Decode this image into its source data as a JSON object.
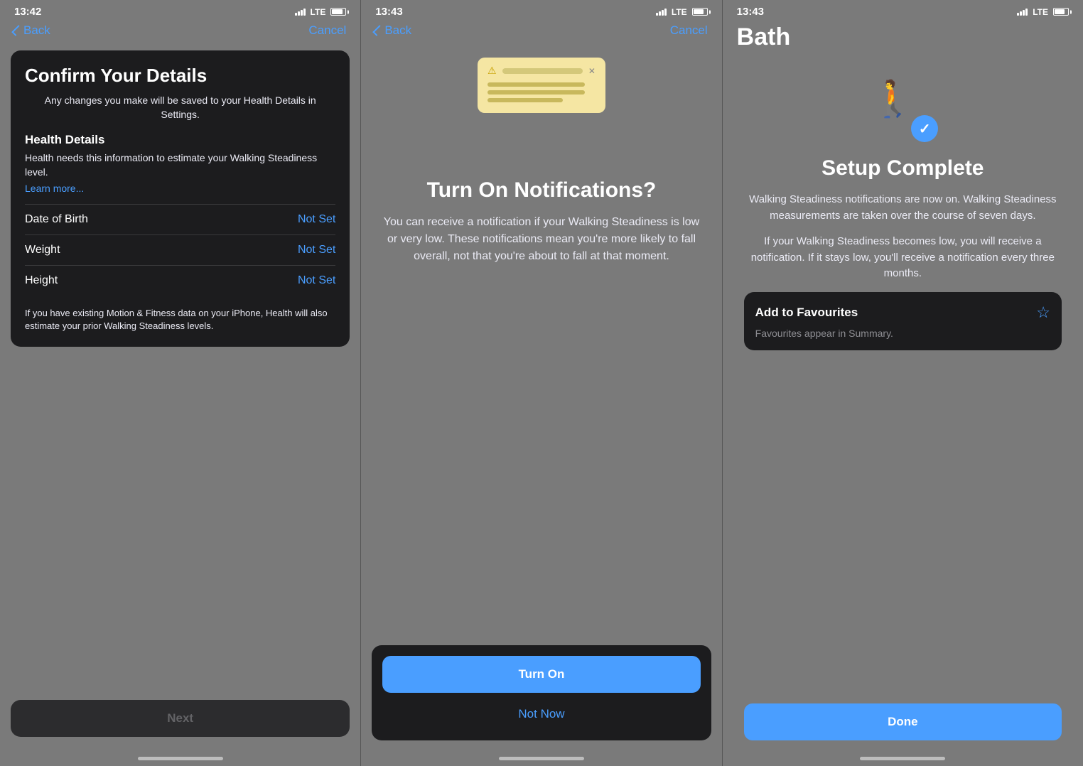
{
  "screen1": {
    "time": "13:42",
    "nav": {
      "back": "Back",
      "cancel": "Cancel"
    },
    "card": {
      "title": "Confirm Your Details",
      "subtitle": "Any changes you make will be saved to your Health Details in Settings.",
      "section_title": "Health Details",
      "section_desc": "Health needs this information to estimate your Walking Steadiness level.",
      "learn_more": "Learn more...",
      "rows": [
        {
          "label": "Date of Birth",
          "value": "Not Set"
        },
        {
          "label": "Weight",
          "value": "Not Set"
        },
        {
          "label": "Height",
          "value": "Not Set"
        }
      ],
      "footer_note": "If you have existing Motion & Fitness data on your iPhone, Health will also estimate your prior Walking Steadiness levels."
    },
    "next_button": "Next"
  },
  "screen2": {
    "time": "13:43",
    "nav": {
      "back": "Back",
      "cancel": "Cancel"
    },
    "title": "Turn On Notifications?",
    "description": "You can receive a notification if your Walking Steadiness is low or very low. These notifications mean you're more likely to fall overall, not that you're about to fall at that moment.",
    "turn_on": "Turn On",
    "not_now": "Not Now"
  },
  "screen3": {
    "time": "13:43",
    "bath_label": "Bath",
    "title": "Setup Complete",
    "description1": "Walking Steadiness notifications are now on. Walking Steadiness measurements are taken over the course of seven days.",
    "description2": "If your Walking Steadiness becomes low, you will receive a notification. If it stays low, you'll receive a notification every three months.",
    "favourites": {
      "title": "Add to Favourites",
      "description": "Favourites appear in Summary."
    },
    "done": "Done"
  },
  "icons": {
    "back_arrow": "‹",
    "star": "☆",
    "checkmark": "✓",
    "warning": "⚠",
    "close": "✕"
  },
  "colors": {
    "accent": "#4A9EFF",
    "background": "#7a7a7a",
    "card_bg": "#1c1c1e",
    "text_primary": "#ffffff",
    "text_secondary": "#ebebf5",
    "text_muted": "#8e8e93",
    "turn_on_bg": "#4A9EFF",
    "row_separator": "#3a3a3c"
  }
}
